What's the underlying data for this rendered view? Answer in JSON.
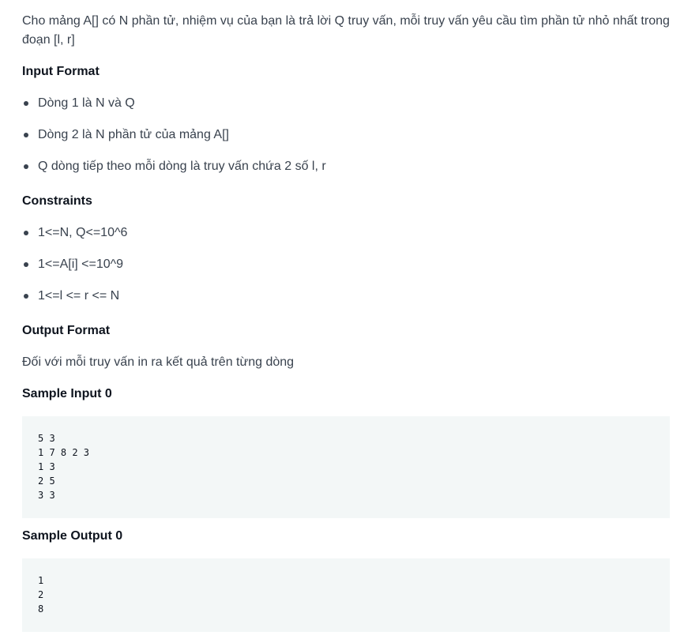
{
  "intro": "Cho mảng A[] có N phần tử, nhiệm vụ của bạn là trả lời Q truy vấn, mỗi truy vấn yêu cầu tìm phần tử nhỏ nhất trong đoạn [l, r]",
  "input_format": {
    "heading": "Input Format",
    "items": [
      "Dòng 1 là N và Q",
      "Dòng 2 là N phần tử của mảng A[]",
      "Q dòng tiếp theo mỗi dòng là truy vấn chứa 2 số l, r"
    ]
  },
  "constraints": {
    "heading": "Constraints",
    "items": [
      "1<=N, Q<=10^6",
      "1<=A[i] <=10^9",
      "1<=l <= r <= N"
    ]
  },
  "output_format": {
    "heading": "Output Format",
    "text": "Đối với mỗi truy vấn in ra kết quả trên từng dòng"
  },
  "sample_input": {
    "heading": "Sample Input 0",
    "lines": [
      "5 3",
      "1 7 8 2 3",
      "1 3",
      "2 5",
      "3 3"
    ]
  },
  "sample_output": {
    "heading": "Sample Output 0",
    "lines": [
      "1",
      "2",
      "8"
    ]
  }
}
